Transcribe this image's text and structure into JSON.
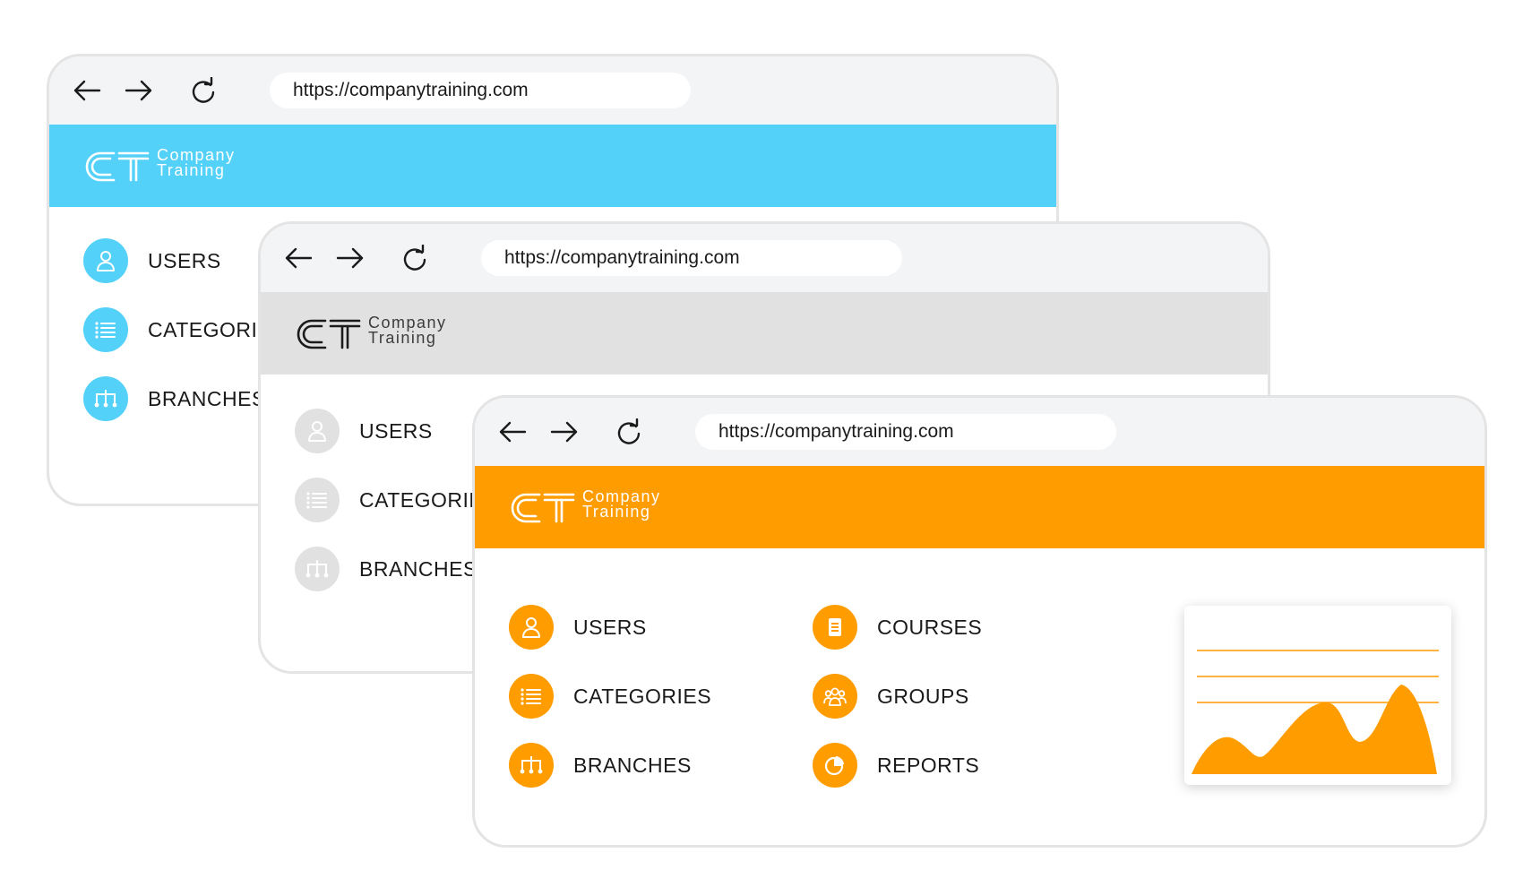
{
  "browser": {
    "url": "https://companytraining.com",
    "icons": {
      "back": "arrow-left-icon",
      "forward": "arrow-right-icon",
      "reload": "reload-icon"
    }
  },
  "brand": {
    "line1": "Company",
    "line2": "Training"
  },
  "themes": {
    "blue": "#54d1f8",
    "gray": "#e1e1e1",
    "orange": "#ff9c00"
  },
  "windows": [
    {
      "theme": "blue",
      "menu": [
        {
          "label": "USERS",
          "icon": "user-icon"
        },
        {
          "label": "CATEGORIES",
          "icon": "list-icon"
        },
        {
          "label": "BRANCHES",
          "icon": "branches-icon"
        }
      ]
    },
    {
      "theme": "gray",
      "menu": [
        {
          "label": "USERS",
          "icon": "user-icon"
        },
        {
          "label": "CATEGORIES",
          "icon": "list-icon"
        },
        {
          "label": "BRANCHES",
          "icon": "branches-icon"
        }
      ]
    },
    {
      "theme": "orange",
      "menu": [
        {
          "label": "USERS",
          "icon": "user-icon"
        },
        {
          "label": "CATEGORIES",
          "icon": "list-icon"
        },
        {
          "label": "BRANCHES",
          "icon": "branches-icon"
        }
      ],
      "menu_right": [
        {
          "label": "COURSES",
          "icon": "courses-icon"
        },
        {
          "label": "GROUPS",
          "icon": "groups-icon"
        },
        {
          "label": "REPORTS",
          "icon": "reports-icon"
        }
      ]
    }
  ]
}
